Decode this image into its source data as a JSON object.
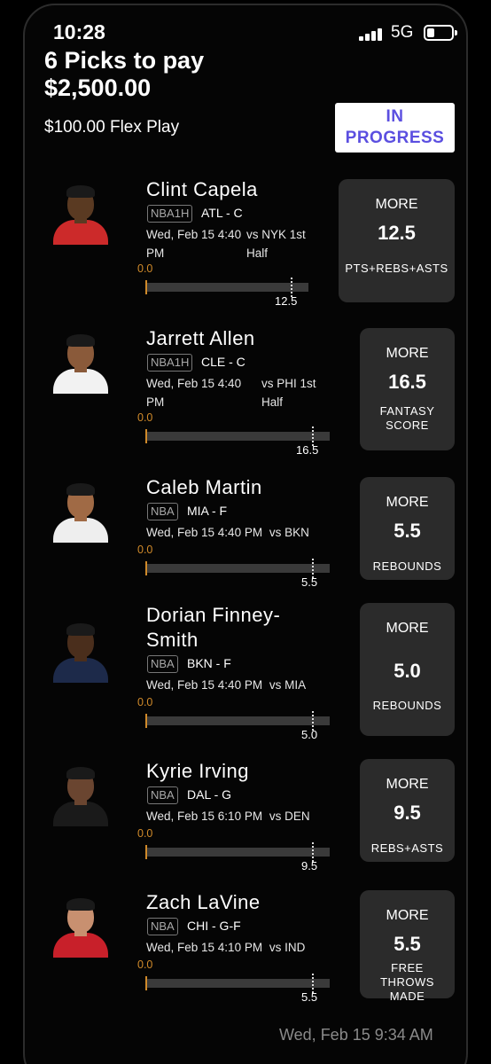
{
  "status_bar": {
    "time": "10:28",
    "network": "5G"
  },
  "header": {
    "title": "6 Picks to pay",
    "amount": "$2,500.00",
    "play_type": "$100.00 Flex Play",
    "status_line1": "IN",
    "status_line2": "PROGRESS"
  },
  "picks": [
    {
      "name": "Clint Capela",
      "league": "NBA1H",
      "team": "ATL - C",
      "game_l1_left": "Wed, Feb 15 4:40",
      "game_l1_right": "vs NYK 1st",
      "game_l2_left": "PM",
      "game_l2_right": "Half",
      "current": "0.0",
      "progress": 0.0,
      "target": "12.5",
      "direction": "MORE",
      "line": "12.5",
      "stat_l1": "PTS+REBS+ASTS",
      "stat_l2": "",
      "stat_l3": "",
      "jersey": "#cc2a2a",
      "skin": "#5a3a22"
    },
    {
      "name": "Jarrett Allen",
      "league": "NBA1H",
      "team": "CLE - C",
      "game_l1_left": "Wed, Feb 15 4:40",
      "game_l1_right": "vs PHI 1st",
      "game_l2_left": "PM",
      "game_l2_right": "Half",
      "current": "0.0",
      "progress": 0.0,
      "target": "16.5",
      "direction": "MORE",
      "line": "16.5",
      "stat_l1": "FANTASY",
      "stat_l2": "SCORE",
      "stat_l3": "",
      "jersey": "#f2f2f2",
      "skin": "#8a5a3a"
    },
    {
      "name": "Caleb Martin",
      "league": "NBA",
      "team": "MIA - F",
      "game_l1_left": "Wed, Feb 15 4:40 PM",
      "game_l1_right": "vs BKN",
      "game_l2_left": "",
      "game_l2_right": "",
      "current": "0.0",
      "progress": 0.0,
      "target": "5.5",
      "direction": "MORE",
      "line": "5.5",
      "stat_l1": "REBOUNDS",
      "stat_l2": "",
      "stat_l3": "",
      "jersey": "#eeeeee",
      "skin": "#a06a45"
    },
    {
      "name": "Dorian Finney-",
      "name2": "Smith",
      "league": "NBA",
      "team": "BKN - F",
      "game_l1_left": "Wed, Feb 15 4:40 PM",
      "game_l1_right": "vs MIA",
      "game_l2_left": "",
      "game_l2_right": "",
      "current": "0.0",
      "progress": 0.0,
      "target": "5.0",
      "direction": "MORE",
      "line": "5.0",
      "stat_l1": "REBOUNDS",
      "stat_l2": "",
      "stat_l3": "",
      "jersey": "#1d2a4a",
      "skin": "#4a2e1c"
    },
    {
      "name": "Kyrie Irving",
      "league": "NBA",
      "team": "DAL - G",
      "game_l1_left": "Wed, Feb 15 6:10 PM",
      "game_l1_right": "vs DEN",
      "game_l2_left": "",
      "game_l2_right": "",
      "current": "0.0",
      "progress": 0.0,
      "target": "9.5",
      "direction": "MORE",
      "line": "9.5",
      "stat_l1": "REBS+ASTS",
      "stat_l2": "",
      "stat_l3": "",
      "jersey": "#1a1a1a",
      "skin": "#6a4530"
    },
    {
      "name": "Zach LaVine",
      "league": "NBA",
      "team": "CHI - G-F",
      "game_l1_left": "Wed, Feb 15 4:10 PM",
      "game_l1_right": "vs IND",
      "game_l2_left": "",
      "game_l2_right": "",
      "current": "0.0",
      "progress": 0.0,
      "target": "5.5",
      "direction": "MORE",
      "line": "5.5",
      "stat_l1": "FREE",
      "stat_l2": "THROWS",
      "stat_l3": "MADE",
      "jersey": "#c8202a",
      "skin": "#c89070"
    }
  ],
  "footer": {
    "timestamp": "Wed, Feb 15 9:34 AM"
  }
}
